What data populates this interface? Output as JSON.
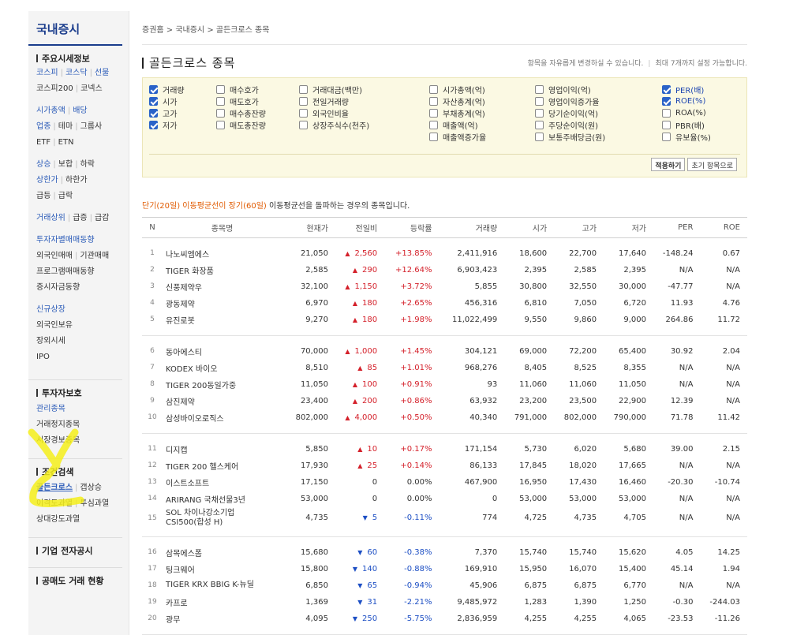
{
  "sidebar": {
    "title": "국내증시",
    "sec1_head": "주요시세정보",
    "links": {
      "kospi": "코스피",
      "kosdaq": "코스닥",
      "futures": "선물",
      "kospi200": "코스피200",
      "konex": "코넥스",
      "mcap": "시가총액",
      "dividend": "배당",
      "sector": "업종",
      "theme": "테마",
      "group": "그룹사",
      "etf": "ETF",
      "etn": "ETN",
      "rise": "상승",
      "flat": "보합",
      "fall": "하락",
      "upper": "상한가",
      "lower": "하한가",
      "surge": "급등",
      "plunge": "급락",
      "volume_top": "거래상위",
      "vol_surge": "급증",
      "vol_plunge": "급감",
      "investor_trade": "투자자별매매동향",
      "foreign_trade": "외국인매매",
      "inst_trade": "기관매매",
      "program_trade": "프로그램매매동향",
      "deposit": "증시자금동향",
      "new_listing": "신규상장",
      "foreign_hold": "외국인보유",
      "off_hours": "장외시세",
      "ipo": "IPO"
    },
    "sec2_head": "투자자보호",
    "protect": {
      "managed": "관리종목",
      "halted": "거래정지종목",
      "warning": "시장경보종목"
    },
    "sec3_head": "조건검색",
    "cond": {
      "golden": "골든크로스",
      "gap": "갭상승",
      "disparity": "이격도과열",
      "psych": "투심과열",
      "relative": "상대강도과열"
    },
    "sec4_head": "기업 전자공시",
    "sec5_head": "공매도 거래 현황"
  },
  "breadcrumb": "증권홈 > 국내증시 > 골든크로스 종목",
  "page_title": "골든크로스 종목",
  "title_note_1": "항목을 자유롭게 변경하실 수 있습니다.",
  "title_note_sep": "|",
  "title_note_2": "최대 7개까지 설정 가능합니다.",
  "filters": {
    "col1": [
      {
        "label": "거래량",
        "checked": true
      },
      {
        "label": "시가",
        "checked": true
      },
      {
        "label": "고가",
        "checked": true
      },
      {
        "label": "저가",
        "checked": true
      }
    ],
    "col2": [
      {
        "label": "매수호가",
        "checked": false
      },
      {
        "label": "매도호가",
        "checked": false
      },
      {
        "label": "매수총잔량",
        "checked": false
      },
      {
        "label": "매도총잔량",
        "checked": false
      }
    ],
    "col3": [
      {
        "label": "거래대금(백만)",
        "checked": false
      },
      {
        "label": "전일거래량",
        "checked": false
      },
      {
        "label": "외국인비율",
        "checked": false
      },
      {
        "label": "상장주식수(천주)",
        "checked": false
      }
    ],
    "col4": [
      {
        "label": "시가총액(억)",
        "checked": false
      },
      {
        "label": "자산총계(억)",
        "checked": false
      },
      {
        "label": "부채총계(억)",
        "checked": false
      },
      {
        "label": "매출액(억)",
        "checked": false
      },
      {
        "label": "매출액증가율",
        "checked": false
      }
    ],
    "col5": [
      {
        "label": "영업이익(억)",
        "checked": false
      },
      {
        "label": "영업이익증가율",
        "checked": false
      },
      {
        "label": "당기순이익(억)",
        "checked": false
      },
      {
        "label": "주당순이익(원)",
        "checked": false
      },
      {
        "label": "보통주배당금(원)",
        "checked": false
      }
    ],
    "col6": [
      {
        "label": "PER(배)",
        "checked": true
      },
      {
        "label": "ROE(%)",
        "checked": true
      },
      {
        "label": "ROA(%)",
        "checked": false
      },
      {
        "label": "PBR(배)",
        "checked": false
      },
      {
        "label": "유보율(%)",
        "checked": false
      }
    ]
  },
  "apply_button": "적용하기",
  "reset_button": "초기 항목으로",
  "description": {
    "highlight": "단기(20일) 이동평균선이 장기(60일)",
    "rest": " 이동평균선을 돌파하는 경우의 종목입니다."
  },
  "columns": [
    "N",
    "종목명",
    "현재가",
    "전일비",
    "등락률",
    "거래량",
    "시가",
    "고가",
    "저가",
    "PER",
    "ROE"
  ],
  "rows": [
    {
      "n": "1",
      "name": "나노씨엠에스",
      "price": "21,050",
      "dir": "up",
      "change": "2,560",
      "rate": "+13.85%",
      "volume": "2,411,916",
      "open": "18,600",
      "high": "22,700",
      "low": "17,640",
      "per": "-148.24",
      "roe": "0.67"
    },
    {
      "n": "2",
      "name": "TIGER 화장품",
      "price": "2,585",
      "dir": "up",
      "change": "290",
      "rate": "+12.64%",
      "volume": "6,903,423",
      "open": "2,395",
      "high": "2,585",
      "low": "2,395",
      "per": "N/A",
      "roe": "N/A"
    },
    {
      "n": "3",
      "name": "신풍제약우",
      "price": "32,100",
      "dir": "up",
      "change": "1,150",
      "rate": "+3.72%",
      "volume": "5,855",
      "open": "30,800",
      "high": "32,550",
      "low": "30,000",
      "per": "-47.77",
      "roe": "N/A"
    },
    {
      "n": "4",
      "name": "광동제약",
      "price": "6,970",
      "dir": "up",
      "change": "180",
      "rate": "+2.65%",
      "volume": "456,316",
      "open": "6,810",
      "high": "7,050",
      "low": "6,720",
      "per": "11.93",
      "roe": "4.76"
    },
    {
      "n": "5",
      "name": "유진로봇",
      "price": "9,270",
      "dir": "up",
      "change": "180",
      "rate": "+1.98%",
      "volume": "11,022,499",
      "open": "9,550",
      "high": "9,860",
      "low": "9,000",
      "per": "264.86",
      "roe": "11.72"
    },
    {
      "n": "6",
      "name": "동아에스티",
      "price": "70,000",
      "dir": "up",
      "change": "1,000",
      "rate": "+1.45%",
      "volume": "304,121",
      "open": "69,000",
      "high": "72,200",
      "low": "65,400",
      "per": "30.92",
      "roe": "2.04"
    },
    {
      "n": "7",
      "name": "KODEX 바이오",
      "price": "8,510",
      "dir": "up",
      "change": "85",
      "rate": "+1.01%",
      "volume": "968,276",
      "open": "8,405",
      "high": "8,525",
      "low": "8,355",
      "per": "N/A",
      "roe": "N/A"
    },
    {
      "n": "8",
      "name": "TIGER 200동일가중",
      "price": "11,050",
      "dir": "up",
      "change": "100",
      "rate": "+0.91%",
      "volume": "93",
      "open": "11,060",
      "high": "11,060",
      "low": "11,050",
      "per": "N/A",
      "roe": "N/A"
    },
    {
      "n": "9",
      "name": "삼진제약",
      "price": "23,400",
      "dir": "up",
      "change": "200",
      "rate": "+0.86%",
      "volume": "63,932",
      "open": "23,200",
      "high": "23,500",
      "low": "22,900",
      "per": "12.39",
      "roe": "N/A"
    },
    {
      "n": "10",
      "name": "삼성바이오로직스",
      "price": "802,000",
      "dir": "up",
      "change": "4,000",
      "rate": "+0.50%",
      "volume": "40,340",
      "open": "791,000",
      "high": "802,000",
      "low": "790,000",
      "per": "71.78",
      "roe": "11.42"
    },
    {
      "n": "11",
      "name": "디지캡",
      "price": "5,850",
      "dir": "up",
      "change": "10",
      "rate": "+0.17%",
      "volume": "171,154",
      "open": "5,730",
      "high": "6,020",
      "low": "5,680",
      "per": "39.00",
      "roe": "2.15"
    },
    {
      "n": "12",
      "name": "TIGER 200 헬스케어",
      "price": "17,930",
      "dir": "up",
      "change": "25",
      "rate": "+0.14%",
      "volume": "86,133",
      "open": "17,845",
      "high": "18,020",
      "low": "17,665",
      "per": "N/A",
      "roe": "N/A"
    },
    {
      "n": "13",
      "name": "이스트소프트",
      "price": "17,150",
      "dir": "flat",
      "change": "0",
      "rate": "0.00%",
      "volume": "467,900",
      "open": "16,950",
      "high": "17,430",
      "low": "16,460",
      "per": "-20.30",
      "roe": "-10.74"
    },
    {
      "n": "14",
      "name": "ARIRANG 국채선물3년",
      "price": "53,000",
      "dir": "flat",
      "change": "0",
      "rate": "0.00%",
      "volume": "0",
      "open": "53,000",
      "high": "53,000",
      "low": "53,000",
      "per": "N/A",
      "roe": "N/A"
    },
    {
      "n": "15",
      "name": "SOL 차이나강소기업 CSI500(합성 H)",
      "price": "4,735",
      "dir": "dn",
      "change": "5",
      "rate": "-0.11%",
      "volume": "774",
      "open": "4,725",
      "high": "4,735",
      "low": "4,705",
      "per": "N/A",
      "roe": "N/A"
    },
    {
      "n": "16",
      "name": "삼목에스폼",
      "price": "15,680",
      "dir": "dn",
      "change": "60",
      "rate": "-0.38%",
      "volume": "7,370",
      "open": "15,740",
      "high": "15,740",
      "low": "15,620",
      "per": "4.05",
      "roe": "14.25"
    },
    {
      "n": "17",
      "name": "팅크웨어",
      "price": "15,800",
      "dir": "dn",
      "change": "140",
      "rate": "-0.88%",
      "volume": "169,910",
      "open": "15,950",
      "high": "16,070",
      "low": "15,400",
      "per": "45.14",
      "roe": "1.94"
    },
    {
      "n": "18",
      "name": "TIGER KRX BBIG K-뉴딜",
      "price": "6,850",
      "dir": "dn",
      "change": "65",
      "rate": "-0.94%",
      "volume": "45,906",
      "open": "6,875",
      "high": "6,875",
      "low": "6,770",
      "per": "N/A",
      "roe": "N/A"
    },
    {
      "n": "19",
      "name": "카프로",
      "price": "1,369",
      "dir": "dn",
      "change": "31",
      "rate": "-2.21%",
      "volume": "9,485,972",
      "open": "1,283",
      "high": "1,390",
      "low": "1,250",
      "per": "-0.30",
      "roe": "-244.03"
    },
    {
      "n": "20",
      "name": "광무",
      "price": "4,095",
      "dir": "dn",
      "change": "250",
      "rate": "-5.75%",
      "volume": "2,836,959",
      "open": "4,255",
      "high": "4,255",
      "low": "4,065",
      "per": "-23.53",
      "roe": "-11.26"
    }
  ],
  "colors": {
    "up": "#d4202a",
    "down": "#1d4fc4",
    "accent": "#1a3c8c",
    "highlight_marker": "#f5ee1a"
  }
}
